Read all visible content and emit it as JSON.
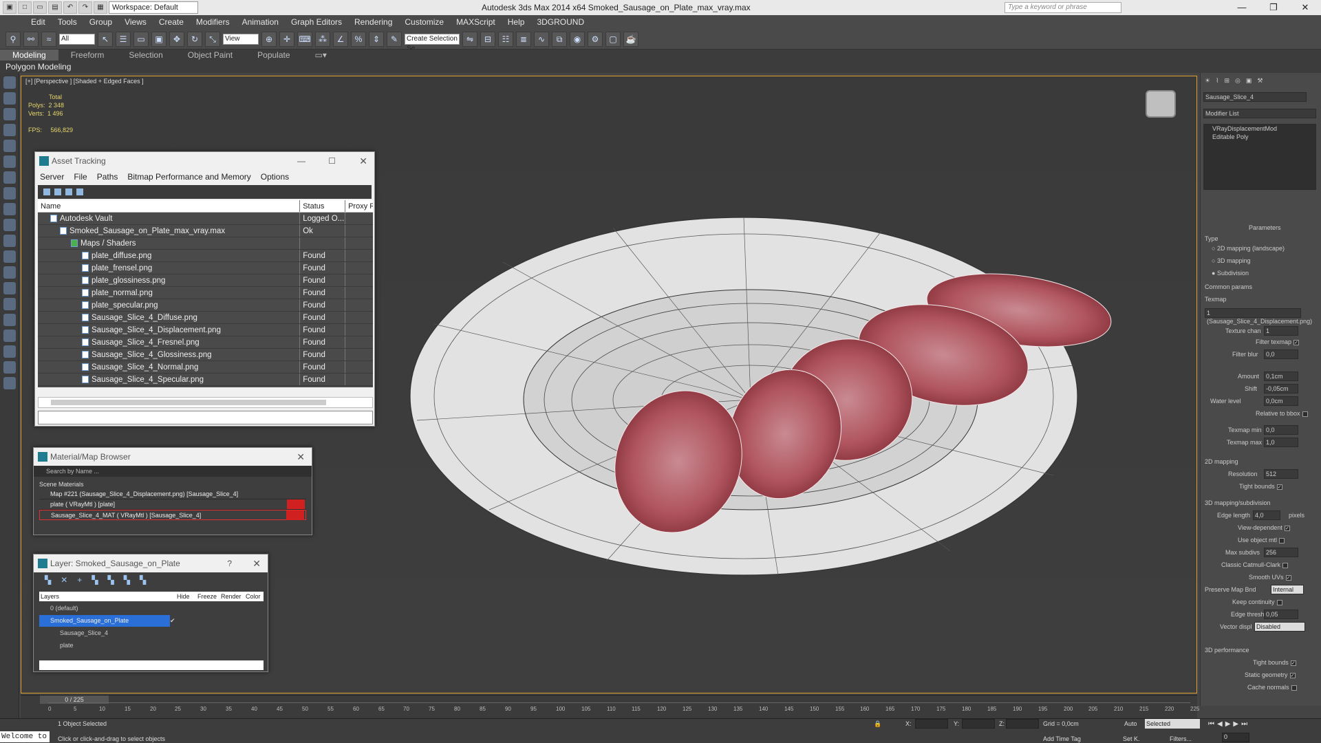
{
  "titlebar": {
    "workspace": "Workspace: Default",
    "app_title": "Autodesk 3ds Max  2014 x64     Smoked_Sausage_on_Plate_max_vray.max",
    "search_placeholder": "Type a keyword or phrase"
  },
  "menu": [
    "Edit",
    "Tools",
    "Group",
    "Views",
    "Create",
    "Modifiers",
    "Animation",
    "Graph Editors",
    "Rendering",
    "Customize",
    "MAXScript",
    "Help",
    "3DGROUND"
  ],
  "toolbar": {
    "filter_value": "All",
    "ref_coord": "View",
    "named_selection_placeholder": "Create Selection Se"
  },
  "ribbon": {
    "tabs": [
      "Modeling",
      "Freeform",
      "Selection",
      "Object Paint",
      "Populate"
    ],
    "active_tab": "Modeling",
    "sub_label": "Polygon Modeling"
  },
  "viewport": {
    "label": "[+] [Perspective ] [Shaded + Edged Faces ]",
    "stats_title": "Total",
    "polys_label": "Polys:",
    "polys": "2 348",
    "verts_label": "Verts:",
    "verts": "1 496",
    "fps_label": "FPS:",
    "fps": "566,829"
  },
  "asset_tracking": {
    "title": "Asset Tracking",
    "menu": [
      "Server",
      "File",
      "Paths",
      "Bitmap Performance and Memory",
      "Options"
    ],
    "columns": [
      "Name",
      "Status",
      "Proxy R"
    ],
    "rows": [
      {
        "name": "Autodesk Vault",
        "status": "Logged O..."
      },
      {
        "name": "Smoked_Sausage_on_Plate_max_vray.max",
        "status": "Ok"
      },
      {
        "name": "Maps / Shaders",
        "status": ""
      },
      {
        "name": "plate_diffuse.png",
        "status": "Found"
      },
      {
        "name": "plate_frensel.png",
        "status": "Found"
      },
      {
        "name": "plate_glossiness.png",
        "status": "Found"
      },
      {
        "name": "plate_normal.png",
        "status": "Found"
      },
      {
        "name": "plate_specular.png",
        "status": "Found"
      },
      {
        "name": "Sausage_Slice_4_Diffuse.png",
        "status": "Found"
      },
      {
        "name": "Sausage_Slice_4_Displacement.png",
        "status": "Found"
      },
      {
        "name": "Sausage_Slice_4_Fresnel.png",
        "status": "Found"
      },
      {
        "name": "Sausage_Slice_4_Glossiness.png",
        "status": "Found"
      },
      {
        "name": "Sausage_Slice_4_Normal.png",
        "status": "Found"
      },
      {
        "name": "Sausage_Slice_4_Specular.png",
        "status": "Found"
      }
    ]
  },
  "material_browser": {
    "title": "Material/Map Browser",
    "search_placeholder": "Search by Name ...",
    "section": "Scene Materials",
    "items": [
      "Map #221 (Sausage_Slice_4_Displacement.png) [Sausage_Slice_4]",
      "plate ( VRayMtl ) [plate]",
      "Sausage_Slice_4_MAT ( VRayMtl ) [Sausage_Slice_4]"
    ]
  },
  "layer_dialog": {
    "title": "Layer: Smoked_Sausage_on_Plate",
    "columns": [
      "Layers",
      "Hide",
      "Freeze",
      "Render",
      "Color"
    ],
    "rows": [
      "0 (default)",
      "Smoked_Sausage_on_Plate",
      "Sausage_Slice_4",
      "plate"
    ]
  },
  "command_panel": {
    "object_name": "Sausage_Slice_4",
    "modifier_list": "Modifier List",
    "stack": [
      "VRayDisplacementMod",
      "Editable Poly"
    ],
    "rollout_title": "Parameters",
    "type_label": "Type",
    "type_options": [
      "2D mapping (landscape)",
      "3D mapping",
      "Subdivision"
    ],
    "common_params": "Common params",
    "texmap_label": "Texmap",
    "texmap_value": "1 (Sausage_Slice_4_Displacement.png)",
    "texture_chan_label": "Texture chan",
    "texture_chan": "1",
    "filter_texmap": "Filter texmap",
    "filter_blur_label": "Filter blur",
    "filter_blur": "0,0",
    "amount_label": "Amount",
    "amount": "0,1cm",
    "shift_label": "Shift",
    "shift": "-0,05cm",
    "water_level_label": "Water level",
    "water_level": "0,0cm",
    "relative_to_bbox": "Relative to bbox",
    "texmap_min_label": "Texmap min",
    "texmap_min": "0,0",
    "texmap_max_label": "Texmap max",
    "texmap_max": "1,0",
    "section_2d": "2D mapping",
    "resolution_label": "Resolution",
    "resolution": "512",
    "tight_bounds": "Tight bounds",
    "section_3d": "3D mapping/subdivision",
    "edge_length_label": "Edge length",
    "edge_length": "4,0",
    "pixels": "pixels",
    "view_dependent": "View-dependent",
    "use_object_mtl": "Use object mtl",
    "max_subdivs_label": "Max subdivs",
    "max_subdivs": "256",
    "classic_catmull": "Classic Catmull-Clark",
    "smooth_uvs": "Smooth UVs",
    "preserve_map_bnd_label": "Preserve Map Bnd",
    "preserve_map_bnd": "Internal",
    "keep_continuity": "Keep continuity",
    "edge_thresh_label": "Edge thresh",
    "edge_thresh": "0,05",
    "vector_displ_label": "Vector displ",
    "vector_displ": "Disabled",
    "section_perf": "3D performance",
    "perf_tight_bounds": "Tight bounds",
    "static_geometry": "Static geometry",
    "cache_normals": "Cache normals"
  },
  "timeline": {
    "frame": "0 / 225",
    "ticks": [
      "0",
      "5",
      "10",
      "15",
      "20",
      "25",
      "30",
      "35",
      "40",
      "45",
      "50",
      "55",
      "60",
      "65",
      "70",
      "75",
      "80",
      "85",
      "90",
      "95",
      "100",
      "105",
      "110",
      "115",
      "120",
      "125",
      "130",
      "135",
      "140",
      "145",
      "150",
      "155",
      "160",
      "165",
      "170",
      "175",
      "180",
      "185",
      "190",
      "195",
      "200",
      "205",
      "210",
      "215",
      "220",
      "225"
    ]
  },
  "status": {
    "listener": "Welcome to",
    "selection": "1 Object Selected",
    "prompt": "Click or click-and-drag to select objects",
    "x_label": "X:",
    "y_label": "Y:",
    "z_label": "Z:",
    "grid": "Grid = 0,0cm",
    "add_time_tag": "Add Time Tag",
    "auto": "Auto",
    "set_k": "Set K.",
    "key_filter": "Selected",
    "filters": "Filters...",
    "frame_value": "0"
  }
}
